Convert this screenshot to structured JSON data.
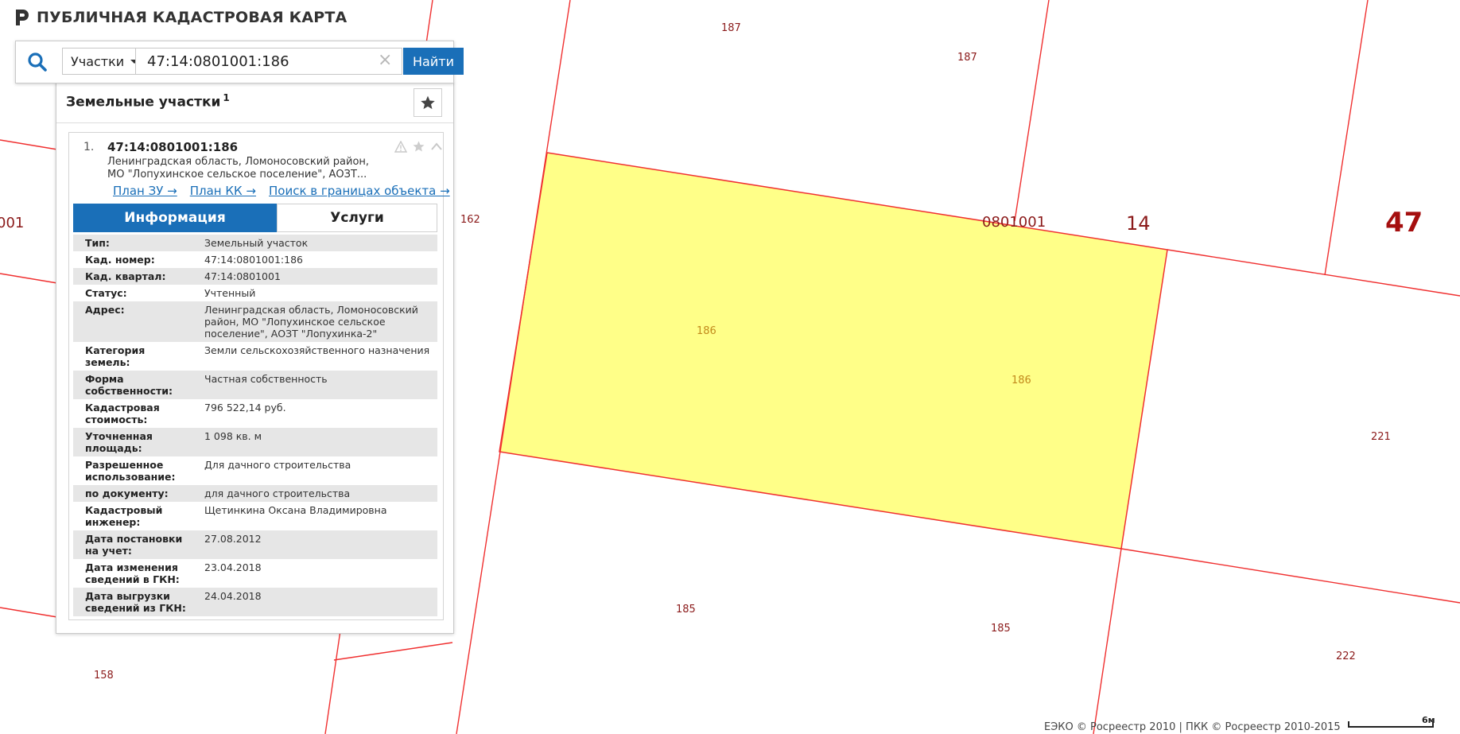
{
  "app": {
    "title": "ПУБЛИЧНАЯ КАДАСТРОВАЯ КАРТА"
  },
  "search": {
    "type_label": "Участки",
    "query": "47:14:0801001:186",
    "button_label": "Найти"
  },
  "results": {
    "title": "Земельные участки",
    "count": "1",
    "item": {
      "index": "1.",
      "title": "47:14:0801001:186",
      "address": "Ленинградская область, Ломоносовский район, МО \"Лопухинское сельское поселение\", АОЗТ...",
      "links": [
        "План ЗУ →",
        "План КК →",
        "Поиск в границах объекта →"
      ],
      "tabs": [
        "Информация",
        "Услуги"
      ],
      "attributes": [
        {
          "key": "Тип:",
          "value": "Земельный участок"
        },
        {
          "key": "Кад. номер:",
          "value": "47:14:0801001:186"
        },
        {
          "key": "Кад. квартал:",
          "value": "47:14:0801001"
        },
        {
          "key": "Статус:",
          "value": "Учтенный"
        },
        {
          "key": "Адрес:",
          "value": "Ленинградская область, Ломоносовский район, МО \"Лопухинское сельское поселение\", АОЗТ \"Лопухинка-2\""
        },
        {
          "key": "Категория земель:",
          "value": "Земли сельскохозяйственного назначения"
        },
        {
          "key": "Форма собственности:",
          "value": "Частная собственность"
        },
        {
          "key": "Кадастровая стоимость:",
          "value": "796 522,14 руб."
        },
        {
          "key": "Уточненная площадь:",
          "value": "1 098 кв. м"
        },
        {
          "key": "Разрешенное использование:",
          "value": "Для дачного строительства"
        },
        {
          "key": "по документу:",
          "value": "для дачного строительства"
        },
        {
          "key": "Кадастровый инженер:",
          "value": "Щетинкина Оксана Владимировна"
        },
        {
          "key": "Дата постановки на учет:",
          "value": "27.08.2012"
        },
        {
          "key": "Дата изменения сведений в ГКН:",
          "value": "23.04.2018"
        },
        {
          "key": "Дата выгрузки сведений из ГКН:",
          "value": "24.04.2018"
        }
      ]
    }
  },
  "map": {
    "parcel_labels": [
      "187",
      "187",
      "162",
      "186",
      "186",
      "185",
      "185",
      "221",
      "222",
      "158"
    ],
    "quarter_label": "0801001",
    "district_label": "14",
    "region_label": "47",
    "edge_label": "001"
  },
  "footer": {
    "copyright": "ЕЭКО © Росреестр 2010 | ПКК © Росреестр 2010-2015",
    "scale_label": "6м"
  },
  "colors": {
    "accent": "#1a6fb8",
    "boundary": "#f03030",
    "selected_fill": "#ffff88",
    "label": "#8b1a1a"
  },
  "icons": {
    "search": "search-icon",
    "favorites": "star-icon",
    "clear": "close-icon"
  }
}
